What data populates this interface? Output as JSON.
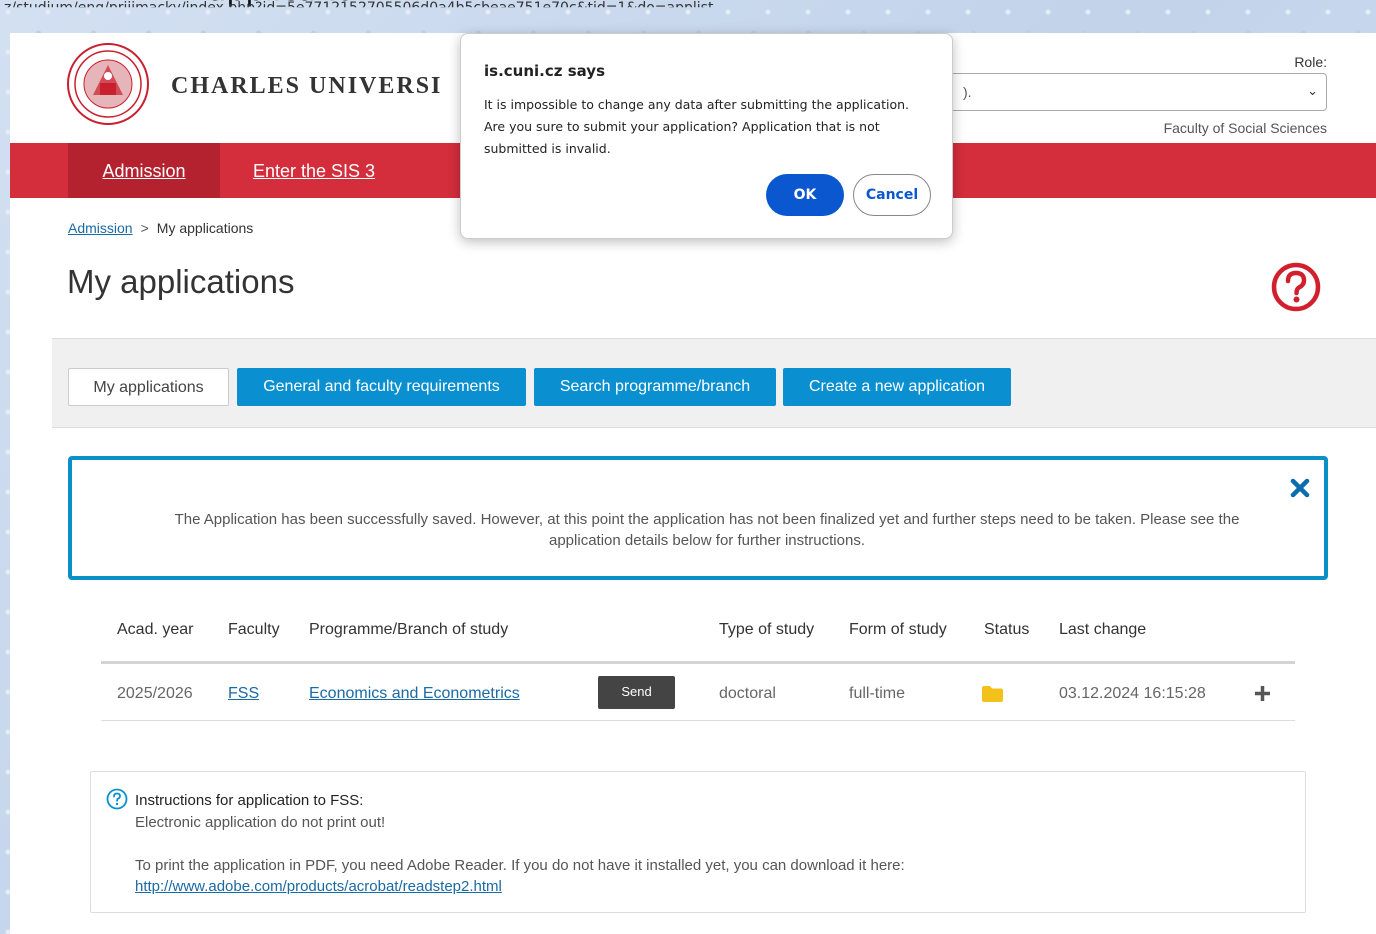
{
  "caption": "application.",
  "url": "z/studium/eng/prijimacky/index.php?id=5e7712152705506d0a4b5cbeae751e70c&tid=1&do=applist",
  "header": {
    "university_name": "CHARLES UNIVERSI",
    "role_label": "Role:",
    "role_value": ").",
    "faculty_note": "Faculty of Social Sciences"
  },
  "nav": {
    "admission": "Admission",
    "sis": "Enter the SIS 3"
  },
  "breadcrumb": {
    "home": "Admission",
    "separator": ">",
    "current": "My applications"
  },
  "page_title": "My applications",
  "tabs": {
    "my": "My applications",
    "general": "General and faculty requirements",
    "search": "Search programme/branch",
    "create": "Create a new application"
  },
  "alert": {
    "text": "The Application has been successfully saved. However, at this point the application has not been finalized yet and further steps need to be taken. Please see the application details below for further instructions."
  },
  "table": {
    "headers": {
      "acad_year": "Acad. year",
      "faculty": "Faculty",
      "programme": "Programme/Branch of study",
      "type": "Type of study",
      "form": "Form of study",
      "status": "Status",
      "last_change": "Last change"
    },
    "rows": [
      {
        "acad_year": "2025/2026",
        "faculty": "FSS",
        "programme": "Economics and Econometrics",
        "action": "Send",
        "type": "doctoral",
        "form": "full-time",
        "status_icon": "folder-icon",
        "last_change": "03.12.2024 16:15:28"
      }
    ]
  },
  "instructions": {
    "title": "Instructions for application to FSS:",
    "line1": "Electronic application do not print out!",
    "line2": "To print the application in PDF, you need Adobe Reader. If you do not have it installed yet, you can download it here:",
    "link": "http://www.adobe.com/products/acrobat/readstep2.html"
  },
  "dialog": {
    "title": "is.cuni.cz says",
    "message": "It is impossible to change any data after submitting the application. Are you sure to submit your application? Application that is not submitted is invalid.",
    "ok": "OK",
    "cancel": "Cancel"
  },
  "colors": {
    "nav_red": "#d42d3c",
    "nav_active": "#b5222f",
    "tab_blue": "#0a8fd0",
    "alert_border": "#0a8fc6",
    "dialog_blue": "#0b57d0",
    "help_red": "#d21f2c",
    "folder_yellow": "#f3c21a"
  }
}
